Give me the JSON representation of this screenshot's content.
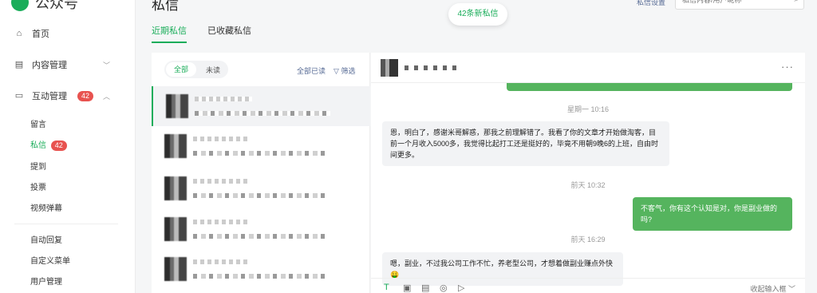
{
  "app": {
    "logo_text": "公众号"
  },
  "sidebar": {
    "home": "首页",
    "content": "内容管理",
    "interaction": "互动管理",
    "interaction_badge": "42",
    "sub": [
      "留言",
      "私信",
      "提到",
      "投票",
      "视频弹幕"
    ],
    "private_badge": "42",
    "more": [
      "自动回复",
      "自定义菜单",
      "用户管理"
    ]
  },
  "header": {
    "title": "私信",
    "tabs": [
      "近期私信",
      "已收藏私信"
    ],
    "new_messages": "42条新私信",
    "settings": "私信设置",
    "search_placeholder": "私信内容/用户昵称"
  },
  "list": {
    "filter_all": "全部",
    "filter_unread": "未读",
    "mark_all_read": "全部已读",
    "filter": "筛选"
  },
  "chat": {
    "messages": [
      {
        "time": "星期一 10:16",
        "dir": "in",
        "text": "恩，明白了，感谢米哥解惑，那我之前理解错了。我看了你的文章才开始做淘客，目前一个月收入5000多，我觉得比起打工还是挺好的，毕竟不用朝9晚6的上班，自由时间更多。"
      },
      {
        "time": "前天 10:32",
        "dir": "out",
        "text": "不客气，你有这个认知是对，你是副业做的吗?"
      },
      {
        "time": "前天 16:29",
        "dir": "in",
        "text": "嗯，副业，不过我公司工作不忙，养老型公司，才想着做副业赚点外快🤑"
      }
    ],
    "collapse_label": "收起输入框"
  },
  "colors": {
    "accent": "#1aad5a",
    "badge": "#e8524f",
    "link": "#576b95"
  }
}
